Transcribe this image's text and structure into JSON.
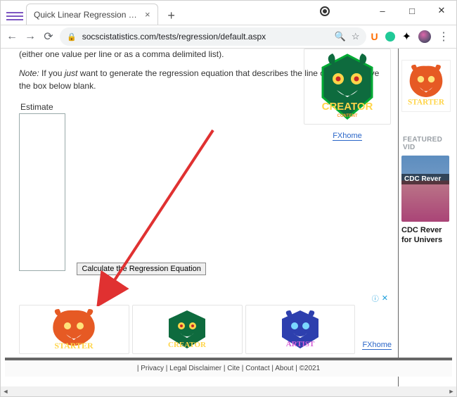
{
  "browser": {
    "tab_title": "Quick Linear Regression Calculat",
    "url": "socscistatistics.com/tests/regression/default.aspx",
    "window_controls": {
      "minimize": "–",
      "maximize": "□",
      "close": "✕"
    },
    "extensions": {
      "u": "U"
    }
  },
  "page": {
    "intro_line": "(either one value per line or as a comma delimited list).",
    "note_label": "Note:",
    "note_text_a": " If you ",
    "note_just": "just",
    "note_text_b": " want to generate the regression equation that describes the line of best fit, leave the box below blank.",
    "estimate_label": "Estimate",
    "estimate_value": "",
    "calc_button": "Calculate the Regression Equation"
  },
  "ads": {
    "top_link": "FXhome",
    "row_link": "FXhome",
    "info_glyph": "ⓘ",
    "close_glyph": "✕",
    "logos": {
      "creator_text": "CREATOR",
      "creator_sub": "CONTENT",
      "starter_text": "STARTER",
      "artist_text": "ARTIST"
    }
  },
  "rail": {
    "featured_header": "FEATURED VID",
    "video_overlay": "CDC Rever",
    "video_caption_a": "CDC Rever",
    "video_caption_b": "for Univers"
  },
  "footer": {
    "privacy": "Privacy",
    "legal": "Legal Disclaimer",
    "cite": "Cite",
    "contact": "Contact",
    "about": "About",
    "copyright": "©2021"
  }
}
